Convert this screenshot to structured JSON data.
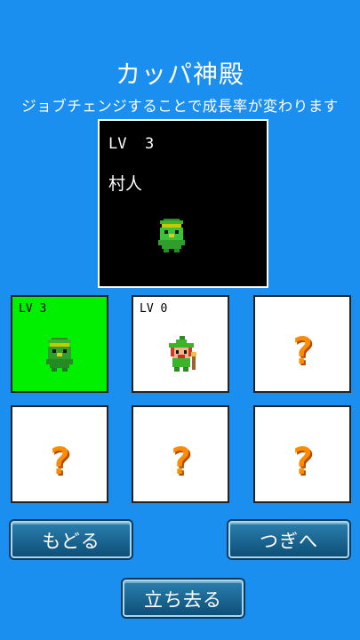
{
  "header": {
    "title": "カッパ神殿",
    "subtitle": "ジョブチェンジすることで成長率が変わります"
  },
  "preview": {
    "level_text": "LV  3",
    "job_name": "村人",
    "sprite": "kappa-villager-icon"
  },
  "job_slots": [
    {
      "level": "LV 3",
      "sprite": "kappa-villager-icon",
      "selected": true
    },
    {
      "level": "LV 0",
      "sprite": "kappa-mage-icon",
      "selected": false
    },
    {
      "unknown": "?"
    },
    {
      "unknown": "?"
    },
    {
      "unknown": "?"
    },
    {
      "unknown": "?"
    }
  ],
  "buttons": {
    "back": "もどる",
    "next": "つぎへ",
    "leave": "立ち去る"
  },
  "colors": {
    "background": "#1a8ff0",
    "selected_slot": "#00f000",
    "question_mark": "#ff8c00",
    "button": "#1b6a97"
  }
}
